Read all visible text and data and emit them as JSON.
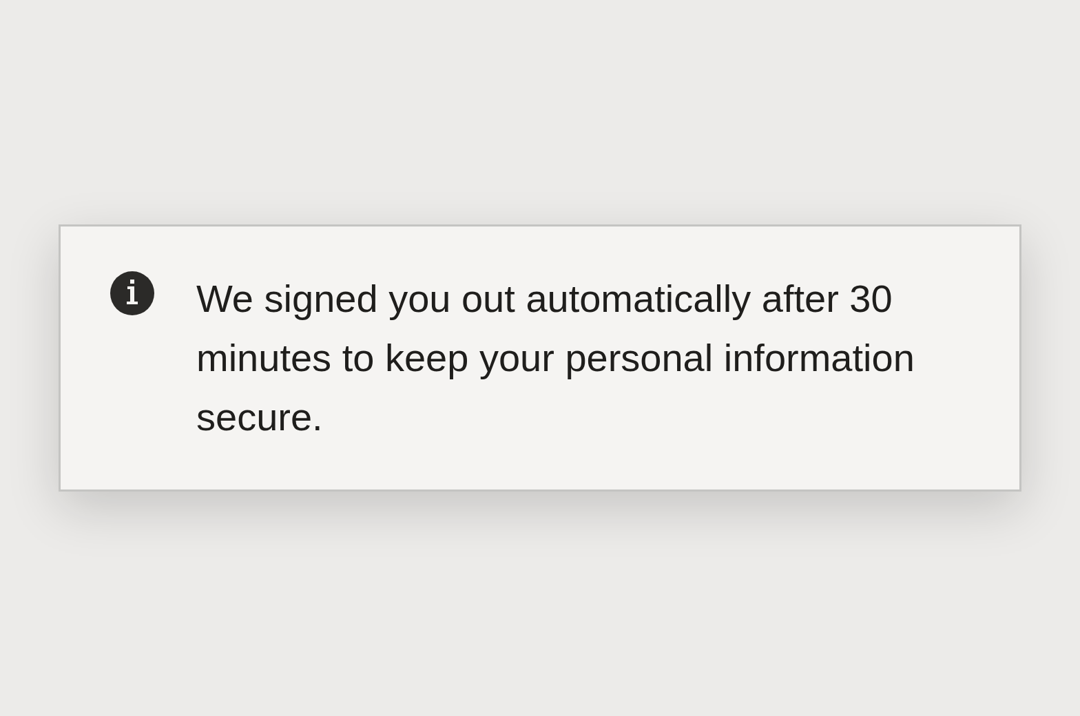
{
  "alert": {
    "kind": "info",
    "message": "We signed you out automatically after 30 minutes to keep your personal information secure."
  }
}
